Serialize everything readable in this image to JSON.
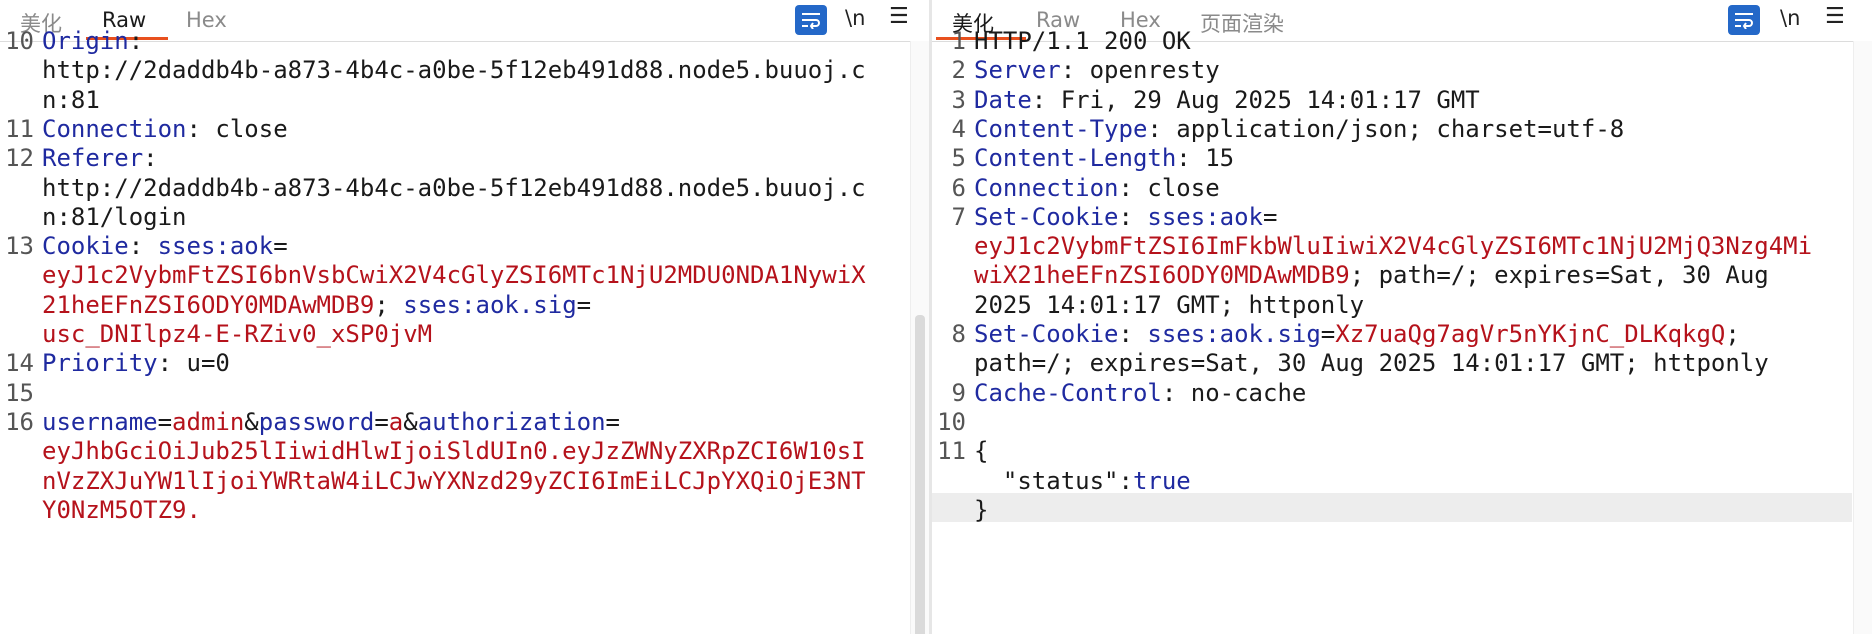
{
  "left": {
    "tabs": [
      "美化",
      "Raw",
      "Hex"
    ],
    "active_tab": "Raw",
    "toolbar": {
      "newline_label": "\\n",
      "menu_label": "☰"
    },
    "lines": [
      {
        "n": "10",
        "key": "Origin",
        "sep": ":",
        "value": ""
      },
      {
        "n": "",
        "text": "http://2daddb4b-a873-4b4c-a0be-5f12eb491d88.node5.buuoj.c"
      },
      {
        "n": "",
        "text": "n:81"
      },
      {
        "n": "11",
        "key": "Connection",
        "sep": ": ",
        "value": "close"
      },
      {
        "n": "12",
        "key": "Referer",
        "sep": ":",
        "value": ""
      },
      {
        "n": "",
        "text": "http://2daddb4b-a873-4b4c-a0be-5f12eb491d88.node5.buuoj.c"
      },
      {
        "n": "",
        "text": "n:81/login"
      },
      {
        "n": "13",
        "key": "Cookie",
        "sep": ": ",
        "ck": "sses:aok",
        "eq": "="
      },
      {
        "n": "",
        "red": "eyJ1c2VybmFtZSI6bnVsbCwiX2V4cGlyZSI6MTc1NjU2MDU0NDA1NywiX"
      },
      {
        "n": "",
        "red": "21heEFnZSI6ODY0MDAwMDB9",
        "semi": "; ",
        "ck2": "sses:aok.sig",
        "eq2": "="
      },
      {
        "n": "",
        "red": "usc_DNIlpz4-E-RZiv0_xSP0jvM"
      },
      {
        "n": "14",
        "key": "Priority",
        "sep": ": ",
        "value": "u=0"
      },
      {
        "n": "15",
        "text": ""
      },
      {
        "n": "16",
        "body": true
      },
      {
        "n": "",
        "red": "eyJhbGciOiJub25lIiwidHlwIjoiSldUIn0.eyJzZWNyZXRpZCI6W10sI"
      },
      {
        "n": "",
        "red": "nVzZXJuYW1lIjoiYWRtaW4iLCJwYXNzd29yZCI6ImEiLCJpYXQiOjE3NT"
      },
      {
        "n": "",
        "red": "Y0NzM5OTZ9."
      }
    ],
    "body_params": [
      {
        "key": "username",
        "value": "admin"
      },
      {
        "key": "password",
        "value": "a"
      },
      {
        "key": "authorization",
        "value": ""
      }
    ]
  },
  "right": {
    "tabs": [
      "美化",
      "Raw",
      "Hex",
      "页面渲染"
    ],
    "active_tab": "美化",
    "toolbar": {
      "newline_label": "\\n",
      "menu_label": "☰"
    },
    "lines": [
      {
        "n": "1",
        "text": "HTTP/1.1 200 OK"
      },
      {
        "n": "2",
        "key": "Server",
        "sep": ": ",
        "value": "openresty"
      },
      {
        "n": "3",
        "key": "Date",
        "sep": ": ",
        "value": "Fri, 29 Aug 2025 14:01:17 GMT"
      },
      {
        "n": "4",
        "key": "Content-Type",
        "sep": ": ",
        "value": "application/json; charset=utf-8"
      },
      {
        "n": "5",
        "key": "Content-Length",
        "sep": ": ",
        "value": "15"
      },
      {
        "n": "6",
        "key": "Connection",
        "sep": ": ",
        "value": "close"
      },
      {
        "n": "7",
        "key": "Set-Cookie",
        "sep": ": ",
        "ck": "sses:aok",
        "eq": "="
      },
      {
        "n": "",
        "red": "eyJ1c2VybmFtZSI6ImFkbWluIiwiX2V4cGlyZSI6MTc1NjU2MjQ3Nzg4Mi"
      },
      {
        "n": "",
        "red": "wiX21heEFnZSI6ODY0MDAwMDB9",
        "tail": "; path=/; expires=Sat, 30 Aug"
      },
      {
        "n": "",
        "text": "2025 14:01:17 GMT; httponly"
      },
      {
        "n": "8",
        "key": "Set-Cookie",
        "sep": ": ",
        "ck": "sses:aok.sig",
        "eq": "=",
        "red2": "Xz7uaQg7agVr5nYKjnC_DLKqkgQ",
        "tail2": ";"
      },
      {
        "n": "",
        "text": "path=/; expires=Sat, 30 Aug 2025 14:01:17 GMT; httponly"
      },
      {
        "n": "9",
        "key": "Cache-Control",
        "sep": ": ",
        "value": "no-cache"
      },
      {
        "n": "10",
        "text": ""
      },
      {
        "n": "11",
        "text": "{"
      },
      {
        "n": "",
        "json": true,
        "jkey": "\"status\"",
        "jsep": ":",
        "jval": "true"
      },
      {
        "n": "",
        "text": "}"
      }
    ]
  }
}
